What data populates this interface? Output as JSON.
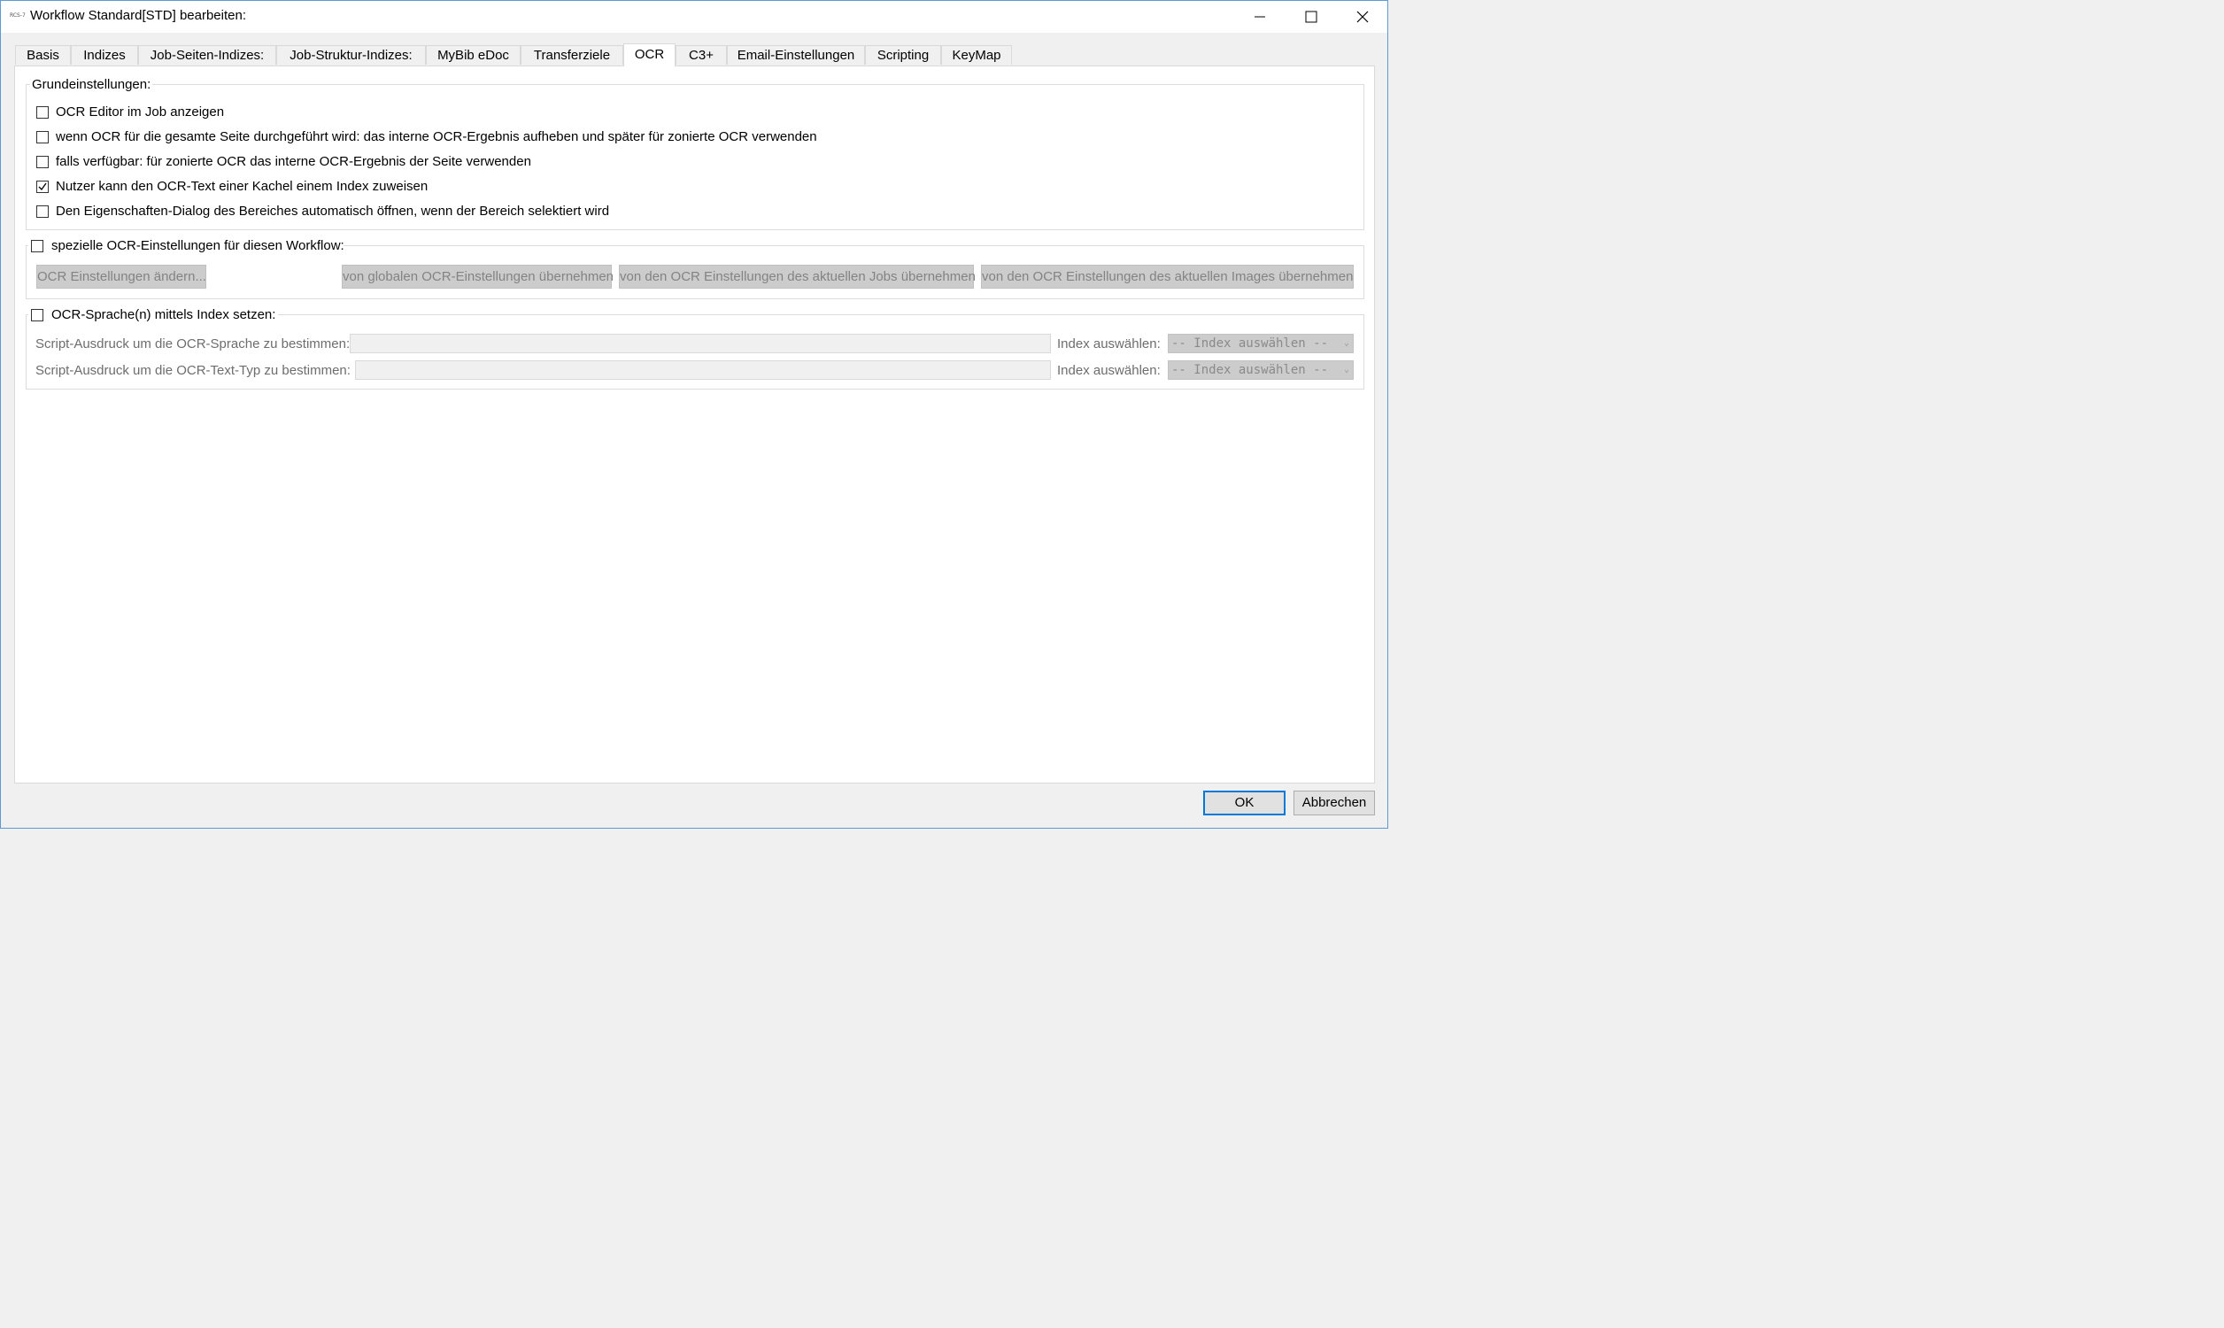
{
  "window": {
    "app_icon_text": "RCS-7",
    "title": "Workflow Standard[STD] bearbeiten:"
  },
  "tabs": [
    {
      "label": "Basis"
    },
    {
      "label": "Indizes"
    },
    {
      "label": "Job-Seiten-Indizes:"
    },
    {
      "label": "Job-Struktur-Indizes:"
    },
    {
      "label": "MyBib eDoc"
    },
    {
      "label": "Transferziele"
    },
    {
      "label": "OCR",
      "active": true
    },
    {
      "label": "C3+"
    },
    {
      "label": "Email-Einstellungen"
    },
    {
      "label": "Scripting"
    },
    {
      "label": "KeyMap"
    }
  ],
  "grundeinstellungen": {
    "title": "Grundeinstellungen:",
    "options": [
      {
        "label": "OCR Editor im Job anzeigen",
        "checked": false
      },
      {
        "label": "wenn OCR für die gesamte Seite durchgeführt wird: das interne OCR-Ergebnis aufheben und später für zonierte OCR verwenden",
        "checked": false
      },
      {
        "label": "falls verfügbar: für zonierte OCR das interne OCR-Ergebnis der Seite verwenden",
        "checked": false
      },
      {
        "label": "Nutzer kann den OCR-Text einer Kachel einem Index zuweisen",
        "checked": true
      },
      {
        "label": "Den Eigenschaften-Dialog des Bereiches automatisch öffnen, wenn der Bereich selektiert wird",
        "checked": false
      }
    ]
  },
  "spezielle": {
    "title": "spezielle OCR-Einstellungen für diesen Workflow:",
    "checked": false,
    "buttons": {
      "aendern": "OCR Einstellungen ändern...",
      "global": "von globalen OCR-Einstellungen übernehmen",
      "job": "von den OCR Einstellungen des aktuellen Jobs übernehmen",
      "image": "von den OCR Einstellungen des aktuellen Images übernehmen"
    }
  },
  "sprache": {
    "title": "OCR-Sprache(n) mittels Index setzen:",
    "checked": false,
    "rows": [
      {
        "label": "Script-Ausdruck um die OCR-Sprache zu bestimmen:",
        "value": "",
        "index_label": "Index auswählen:",
        "select_value": "-- Index auswählen --"
      },
      {
        "label": "Script-Ausdruck um die OCR-Text-Typ zu bestimmen:",
        "value": "",
        "index_label": "Index auswählen:",
        "select_value": "-- Index auswählen --"
      }
    ]
  },
  "footer": {
    "ok": "OK",
    "cancel": "Abbrechen"
  },
  "colors": {
    "window_border": "#5b9bd5",
    "default_button_border": "#0078d7",
    "disabled_button_bg": "#cccccc"
  }
}
